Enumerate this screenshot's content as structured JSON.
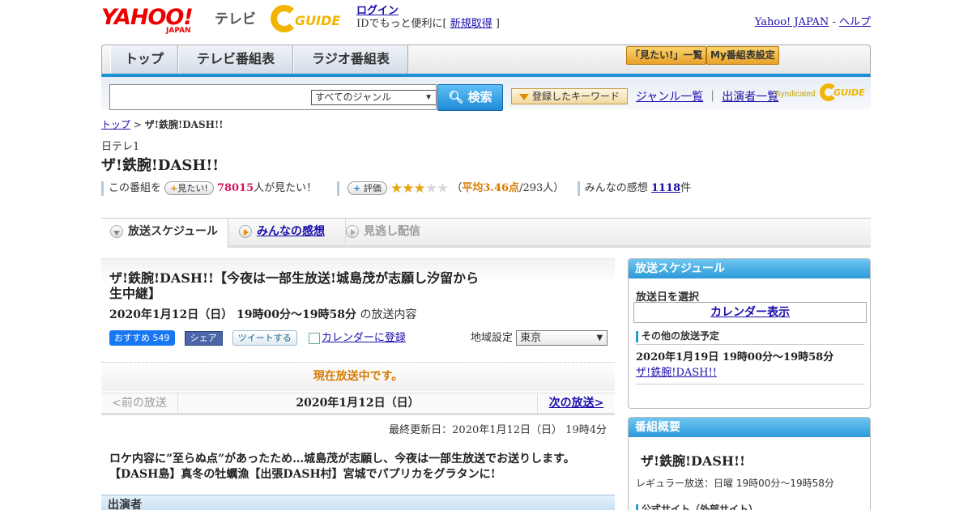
{
  "header": {
    "logo_yahoo": "YAHOO!",
    "logo_japan": "JAPAN",
    "logo_tv": "テレビ",
    "gguide": "GUIDE",
    "login": "ログイン",
    "id_text": "IDでもっと便利に[ ",
    "register": "新規取得",
    "id_close": " ]",
    "yahoo_japan": "Yahoo! JAPAN",
    "sep": " - ",
    "help": "ヘルプ"
  },
  "nav": {
    "tabs": [
      "トップ",
      "テレビ番組表",
      "ラジオ番組表"
    ],
    "want_list": "「見たい!」一覧",
    "my_settings": "My番組表設定"
  },
  "search": {
    "genre": "すべてのジャンル",
    "button": "検索",
    "keyword_btn": "登録したキーワード",
    "genre_list": "ジャンル一覧",
    "link_sep": "｜",
    "cast_list": "出演者一覧",
    "syndicated": "Syndicated",
    "gguide": "GUIDE"
  },
  "breadcrumb": {
    "top": "トップ",
    "sep": " > ",
    "current": "ザ!鉄腕!DASH!!"
  },
  "program": {
    "channel": "日テレ1",
    "title": "ザ!鉄腕!DASH!!",
    "watch_prefix": "この番組を",
    "watch_btn": "見たい!",
    "watch_count": "78015",
    "watch_suffix": "人が見たい！",
    "rate_btn": "評価",
    "rating_stars": 3.46,
    "avg_open": "（",
    "avg_label": "平均3.46点",
    "avg_people": "/293人）",
    "impressions_label": "みんなの感想 ",
    "impressions_count": "1118",
    "impressions_unit": "件"
  },
  "content_tabs": [
    "放送スケジュール",
    "みんなの感想",
    "見逃し配信"
  ],
  "episode": {
    "title": "ザ!鉄腕!DASH!!【今夜は一部生放送!城島茂が志願し汐留から生中継】",
    "time": "2020年1月12日（日）  19時00分～19時58分",
    "time_suffix": " の放送内容",
    "fb_recommend": "おすすめ 549",
    "fb_share": "シェア",
    "tweet": "ツイートする",
    "calendar": "カレンダーに登録",
    "region_label": "地域設定 ",
    "region": "東京",
    "on_air": "現在放送中です。",
    "prev": "<前の放送",
    "current_date": "2020年1月12日（日）",
    "next": "次の放送>",
    "updated": "最終更新日：2020年1月12日（日） 19時4分",
    "description": "ロケ内容に”至らぬ点”があったため…城島茂が志願し、今夜は一部生放送でお送りします。【DASH島】真冬の牡蠣漁【出張DASH村】宮城でパプリカをグラタンに!",
    "cast_header": "出演者"
  },
  "schedule_panel": {
    "header": "放送スケジュール",
    "select_label": "放送日を選択",
    "calendar_btn": "カレンダー表示",
    "other_label": "その他の放送予定",
    "other_date": "2020年1月19日  19時00分～19時58分",
    "other_name": "ザ!鉄腕!DASH!!"
  },
  "summary_panel": {
    "header": "番組概要",
    "title": "ザ!鉄腕!DASH!!",
    "regular": "レギュラー放送：日曜 19時00分～19時58分",
    "site": "公式サイト（外部サイト）"
  },
  "colors": {
    "accent_blue": "#1f8fd6",
    "orange": "#d97a00",
    "pink": "#d4155c",
    "link": "#1a0dab"
  }
}
